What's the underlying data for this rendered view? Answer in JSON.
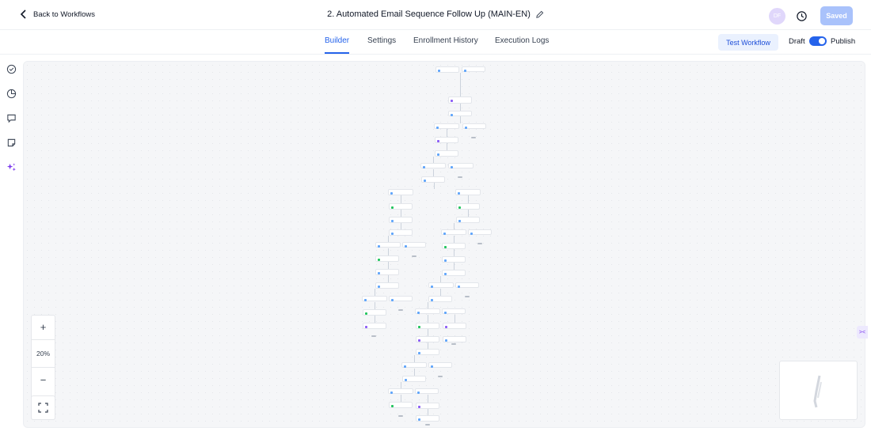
{
  "header": {
    "back_label": "Back to Workflows",
    "title": "2. Automated Email Sequence Follow Up (MAIN-EN)",
    "avatar_initials": "DF",
    "saved_label": "Saved"
  },
  "tabs": [
    {
      "label": "Builder",
      "active": true
    },
    {
      "label": "Settings",
      "active": false
    },
    {
      "label": "Enrollment History",
      "active": false
    },
    {
      "label": "Execution Logs",
      "active": false
    }
  ],
  "actions": {
    "test_workflow_label": "Test Workflow",
    "draft_label": "Draft",
    "publish_label": "Publish",
    "published": true
  },
  "sidebar": {
    "icons": [
      "check-circle-icon",
      "pie-chart-icon",
      "chat-icon",
      "note-icon",
      "ai-sparkle-icon"
    ]
  },
  "canvas": {
    "zoom_level": "20%"
  },
  "colors": {
    "accent": "#2563eb",
    "saved_button": "#a9c2fb",
    "ai_icon": "#7c3aed"
  }
}
